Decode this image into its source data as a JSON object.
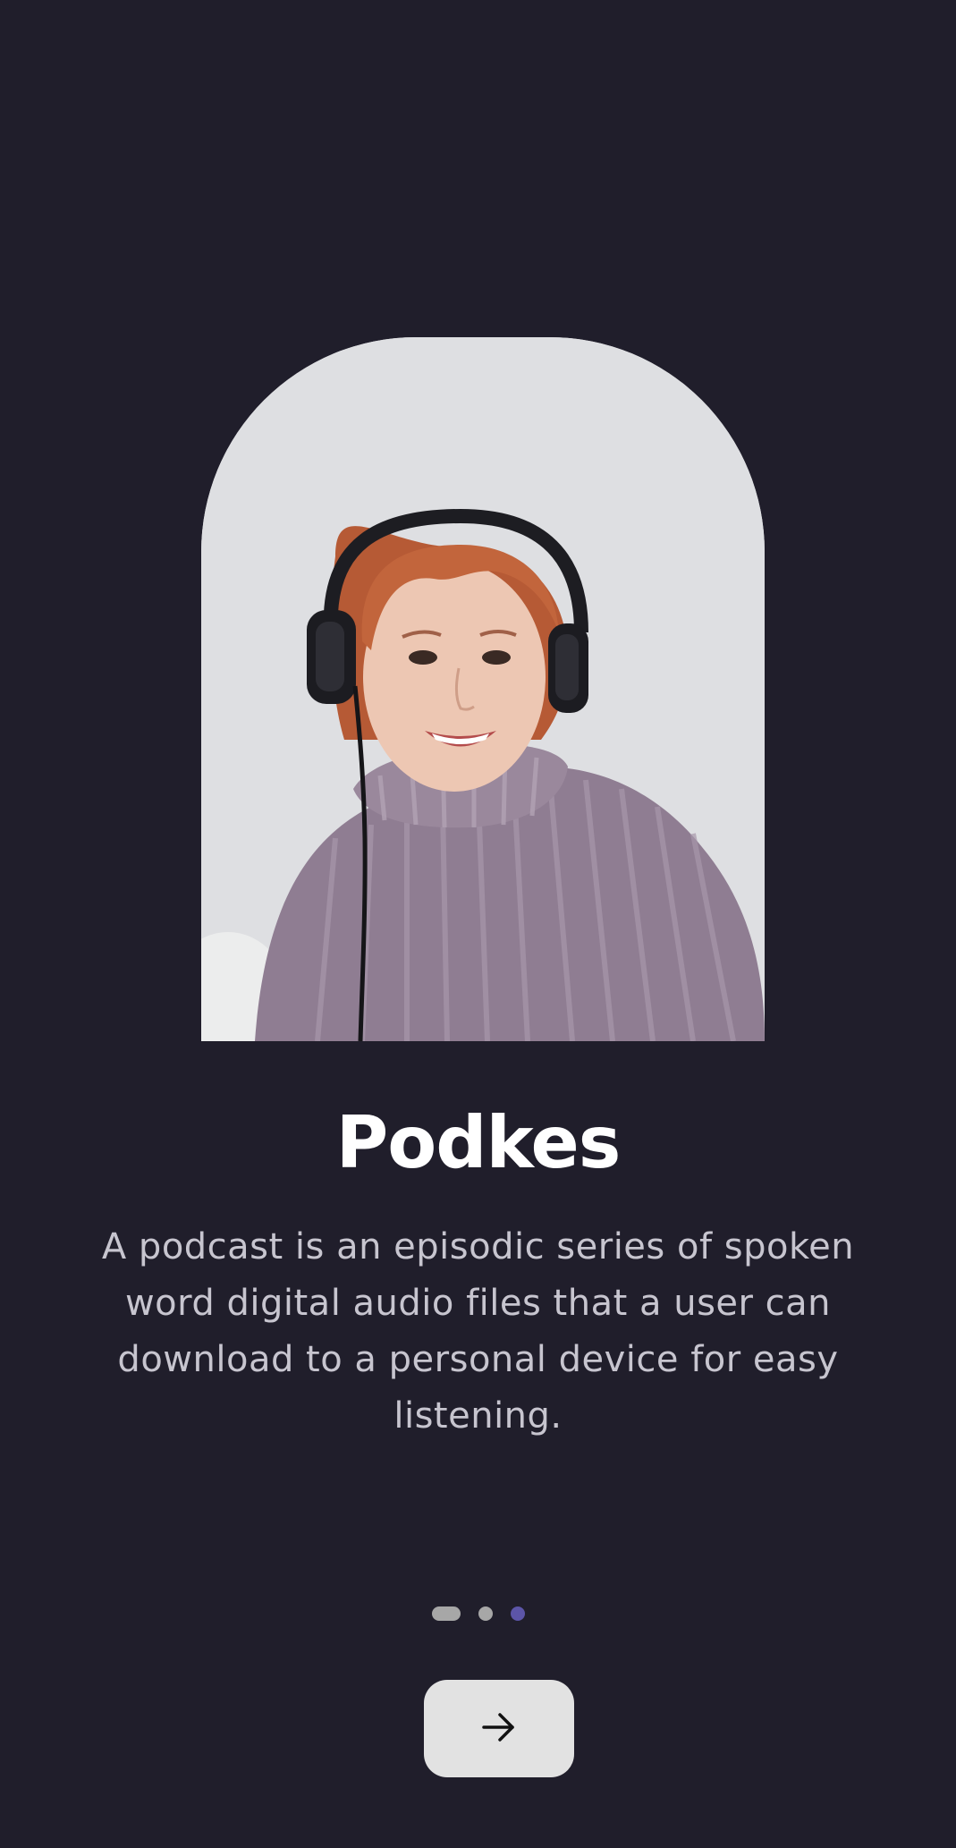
{
  "onboarding": {
    "illustration": "woman-with-headphones-photo",
    "title": "Podkes",
    "description": "A podcast is an episodic series of spoken word digital audio files that a user can download to a personal device for easy listening.",
    "pagination": {
      "total_pages": 3,
      "current_page": 3,
      "colors": {
        "inactive": "#a7a7a7",
        "active": "#5c55a8"
      }
    },
    "next_button": {
      "icon": "arrow-right-icon",
      "color": "#e2e2e2"
    }
  },
  "colors": {
    "background": "#201e2b",
    "title": "#ffffff",
    "description": "#c7c5cf"
  }
}
